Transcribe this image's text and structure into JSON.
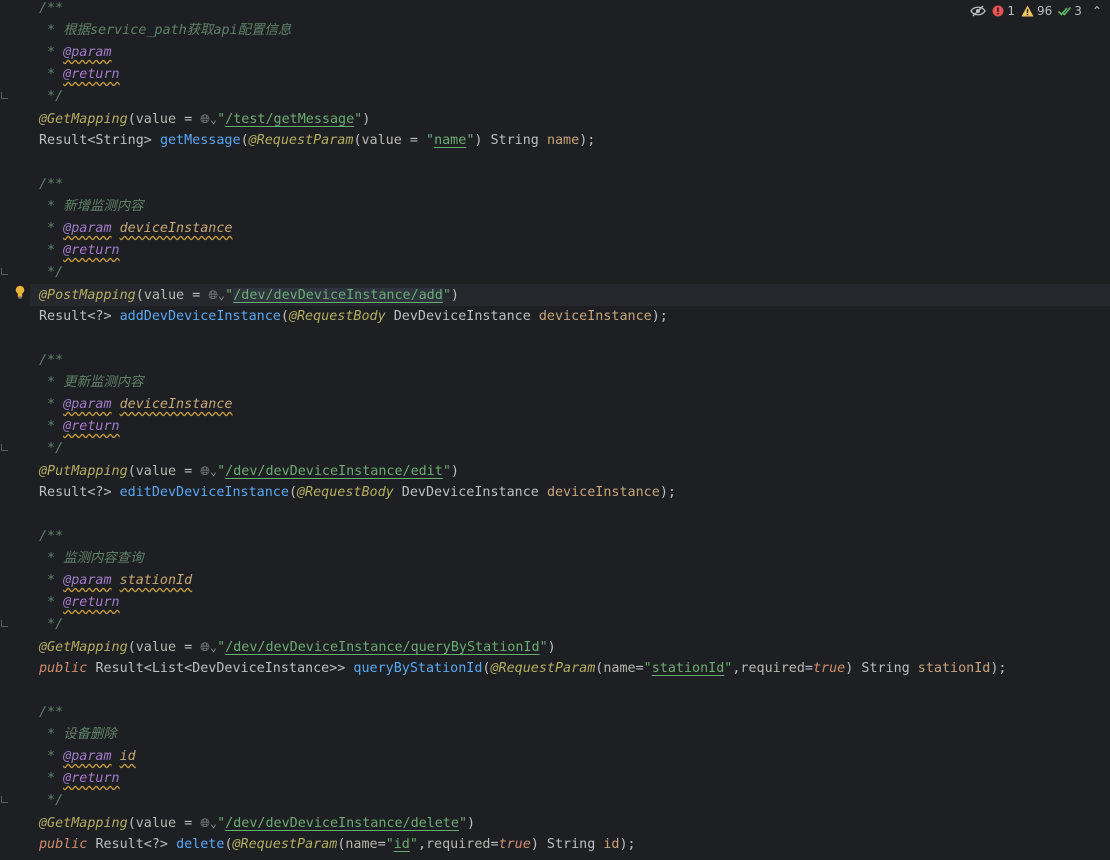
{
  "status": {
    "errors": "1",
    "warnings": "96",
    "ok_checks": "3",
    "colors": {
      "error": "#e55353",
      "warning": "#f2c55c",
      "ok": "#5fb865"
    }
  },
  "doc_start": "/**",
  "doc_prefix": " * ",
  "doc_end": " */",
  "tags": {
    "param": "@param",
    "return": "@return"
  },
  "blocks": [
    {
      "comment": "根据service_path获取api配置信息",
      "param_name": "",
      "annotation": "@GetMapping",
      "value_kw": "value",
      "path": "/test/getMessage",
      "return_type": "Result<String> ",
      "method": "getMessage",
      "param_annotation": "@RequestParam",
      "param_args_a": "value",
      "param_args_eq": " = ",
      "param_value": "name",
      "param_rest": ") String ",
      "param_var": "name",
      "tail": ");"
    },
    {
      "comment": "新增监测内容",
      "param_name": "deviceInstance",
      "annotation": "@PostMapping",
      "value_kw": "value",
      "path": "/dev/devDeviceInstance/add",
      "return_type": "Result<?> ",
      "method": "addDevDeviceInstance",
      "param_annotation": "@RequestBody",
      "param_type": " DevDeviceInstance ",
      "param_var": "deviceInstance",
      "tail": ");"
    },
    {
      "comment": "更新监测内容",
      "param_name": "deviceInstance",
      "annotation": "@PutMapping",
      "value_kw": "value",
      "path": "/dev/devDeviceInstance/edit",
      "return_type": "Result<?> ",
      "method": "editDevDeviceInstance",
      "param_annotation": "@RequestBody",
      "param_type": " DevDeviceInstance ",
      "param_var": "deviceInstance",
      "tail": ");"
    },
    {
      "comment": "监测内容查询",
      "param_name": "stationId",
      "annotation": "@GetMapping",
      "value_kw": "value",
      "path": "/dev/devDeviceInstance/queryByStationId",
      "modifier": "public ",
      "return_type": "Result<List<DevDeviceInstance>> ",
      "method": "queryByStationId",
      "param_annotation": "@RequestParam",
      "param_args_a": "name",
      "param_value": "stationId",
      "param_args_b": "required",
      "param_bool": "true",
      "param_rest": ") String ",
      "param_var": "stationId",
      "tail": ");"
    },
    {
      "comment": "设备删除",
      "param_name": "id",
      "annotation": "@GetMapping",
      "value_kw": "value",
      "path": "/dev/devDeviceInstance/delete",
      "modifier": "public ",
      "return_type": "Result<?> ",
      "method": "delete",
      "param_annotation": "@RequestParam",
      "param_args_a": "name",
      "param_value": "id",
      "param_args_b": "required",
      "param_bool": "true",
      "param_rest": ") String ",
      "param_var": "id",
      "tail": ");"
    }
  ]
}
